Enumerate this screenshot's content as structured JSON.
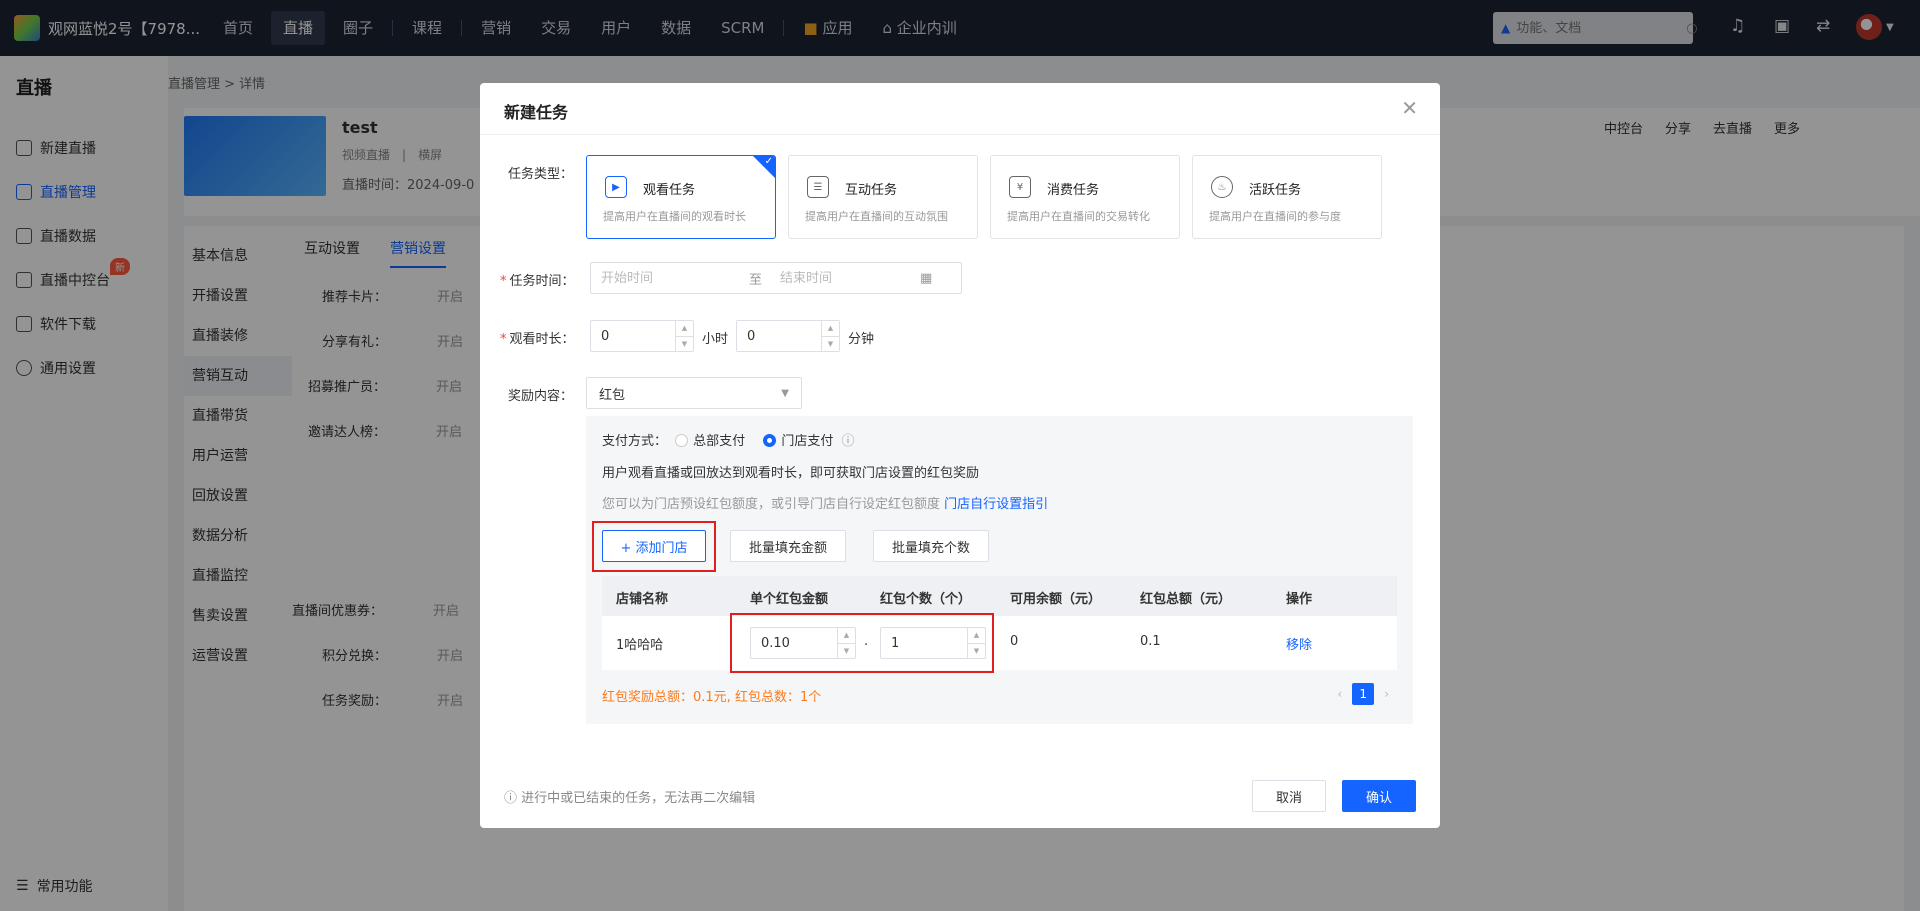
{
  "topbar": {
    "brand": "观网蓝悦2号【7978...",
    "nav": [
      "首页",
      "直播",
      "圈子",
      "课程",
      "营销",
      "交易",
      "用户",
      "数据",
      "SCRM",
      "应用",
      "企业内训"
    ],
    "search_placeholder": "功能、文档"
  },
  "sidebar": {
    "title": "直播",
    "items": [
      "新建直播",
      "直播管理",
      "直播数据",
      "直播中控台",
      "软件下载",
      "通用设置"
    ],
    "badge": "新",
    "footer": "常用功能"
  },
  "main": {
    "breadcrumb": "直播管理 > 详情",
    "live_name": "test",
    "live_type": "视频直播",
    "live_orient": "横屏",
    "live_time": "直播时间：2024-09-0",
    "actions": [
      "中控台",
      "分享",
      "去直播",
      "更多"
    ],
    "tabs": [
      "互动设置",
      "营销设置"
    ],
    "subnav": [
      "基本信息",
      "开播设置",
      "直播装修",
      "营销互动",
      "直播带货",
      "用户运营",
      "回放设置",
      "数据分析",
      "直播监控",
      "售卖设置",
      "运营设置"
    ],
    "settings": [
      "推荐卡片：",
      "分享有礼：",
      "招募推广员：",
      "邀请达人榜：",
      "直播间优惠券：",
      "积分兑换：",
      "任务奖励："
    ],
    "setting_text": "开启"
  },
  "dialog": {
    "title": "新建任务",
    "task_type_label": "任务类型：",
    "task_types": [
      {
        "name": "观看任务",
        "desc": "提高用户在直播间的观看时长"
      },
      {
        "name": "互动任务",
        "desc": "提高用户在直播间的互动氛围"
      },
      {
        "name": "消费任务",
        "desc": "提高用户在直播间的交易转化"
      },
      {
        "name": "活跃任务",
        "desc": "提高用户在直播间的参与度"
      }
    ],
    "task_time_label": "任务时间：",
    "start_placeholder": "开始时间",
    "to": "至",
    "end_placeholder": "结束时间",
    "watch_label": "观看时长：",
    "hours_value": "0",
    "hours_unit": "小时",
    "minutes_value": "0",
    "minutes_unit": "分钟",
    "reward_label": "奖励内容：",
    "reward_value": "红包",
    "pay_label": "支付方式：",
    "pay_options": [
      "总部支付",
      "门店支付"
    ],
    "desc1": "用户观看直播或回放达到观看时长，即可获取门店设置的红包奖励",
    "desc2": "您可以为门店预设红包额度，或引导门店自行设定红包额度",
    "guide_link": "门店自行设置指引",
    "add_store": "+ 添加门店",
    "fill_amount": "批量填充金额",
    "fill_count": "批量填充个数",
    "table_headers": [
      "店铺名称",
      "单个红包金额",
      "红包个数（个）",
      "可用余额（元）",
      "红包总额（元）",
      "操作"
    ],
    "row": {
      "store": "1哈哈哈",
      "amount": "0.10",
      "dot": ".",
      "count": "1",
      "balance": "0",
      "total": "0.1",
      "remove": "移除"
    },
    "summary": "红包奖励总额：0.1元, 红包总数：1个",
    "page": "1",
    "footer_note": "进行中或已结束的任务，无法再二次编辑",
    "cancel": "取消",
    "confirm": "确认"
  }
}
